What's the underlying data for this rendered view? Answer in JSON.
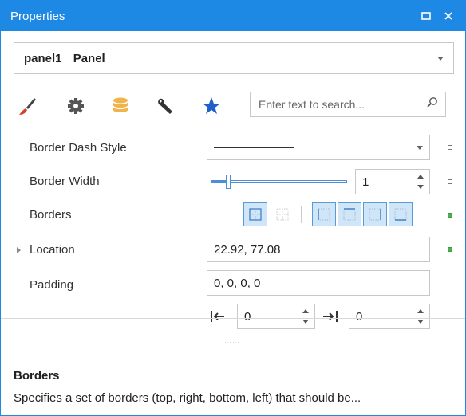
{
  "window": {
    "title": "Properties"
  },
  "selector": {
    "object_name": "panel1",
    "object_type": "Panel"
  },
  "search": {
    "placeholder": "Enter text to search..."
  },
  "toolbar_icons": [
    "brush-icon",
    "gear-icon",
    "database-icon",
    "wrench-icon",
    "star-icon"
  ],
  "properties": {
    "border_dash_style": {
      "label": "Border Dash Style",
      "value": "solid-line"
    },
    "border_width": {
      "label": "Border Width",
      "value": "1",
      "slider_fraction": 0.12
    },
    "borders": {
      "label": "Borders",
      "states": [
        "all",
        "none",
        "left",
        "top",
        "right",
        "bottom"
      ],
      "active": [
        "all",
        "left",
        "top",
        "right",
        "bottom"
      ]
    },
    "location": {
      "label": "Location",
      "value": "22.92, 77.08"
    },
    "padding": {
      "label": "Padding",
      "value": "0, 0, 0, 0",
      "left_value": "0",
      "right_value": "0"
    }
  },
  "description": {
    "title": "Borders",
    "text": "Specifies a set of borders (top, right, bottom, left) that should be..."
  },
  "colors": {
    "accent": "#1e88e5",
    "brush": "#d0402a",
    "database": "#f0b44a",
    "star": "#1e5fc8",
    "modified_marker": "#4caf50"
  }
}
